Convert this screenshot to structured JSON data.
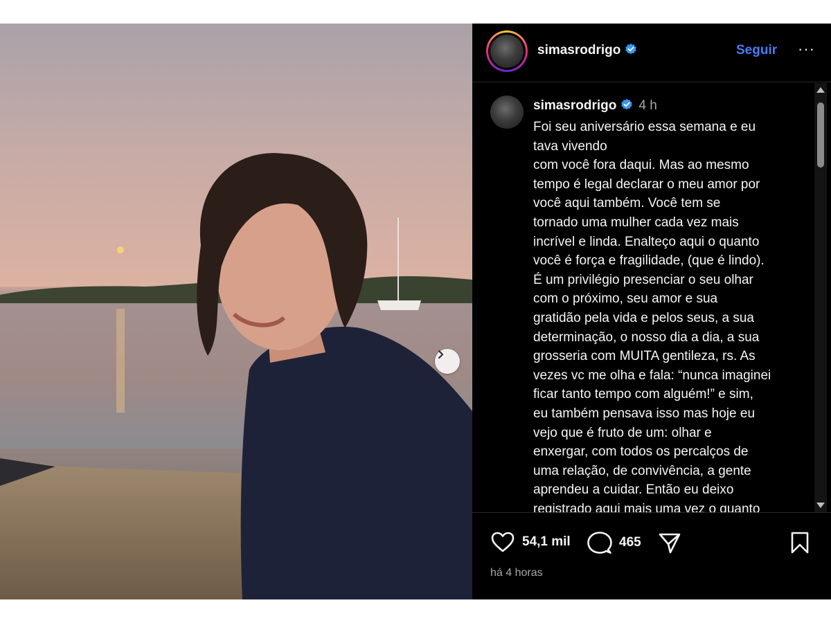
{
  "post": {
    "username": "simasrodrigo",
    "follow_label": "Seguir",
    "more_label": "···",
    "caption_time": "4 h",
    "caption_lines": [
      "Foi seu aniversário essa semana e eu",
      "tava vivendo",
      "com você fora daqui. Mas ao mesmo",
      "tempo é legal declarar o meu amor por",
      "você aqui também. Você tem se",
      "tornado uma mulher cada vez mais",
      "incrível e linda. Enalteço aqui o quanto",
      "você é força e fragilidade, (que é lindo).",
      "É um privilégio presenciar o seu olhar",
      "com o próximo, seu amor e sua",
      "gratidão pela vida e pelos seus, a sua",
      "determinação, o nosso dia a dia, a sua",
      "grosseria com MUITA gentileza, rs. As",
      "vezes vc me olha e fala: “nunca imaginei",
      "ficar tanto tempo com alguém!” e sim,",
      "eu também pensava isso mas hoje eu",
      "vejo que é fruto de um: olhar e",
      "enxergar, com todos os percalços de",
      "uma relação, de convivência, a gente",
      "aprendeu a cuidar. Então eu deixo",
      "registrado aqui mais uma vez o quanto"
    ],
    "likes": "54,1 mil",
    "comments": "465",
    "time_ago": "há 4 horas"
  },
  "colors": {
    "follow": "#4a7cf5",
    "verified": "#3897f0",
    "panel_bg": "#000000"
  },
  "icons": [
    "verified-badge-icon",
    "heart-icon",
    "comment-icon",
    "share-icon",
    "bookmark-icon",
    "chevron-right-icon",
    "more-icon"
  ]
}
